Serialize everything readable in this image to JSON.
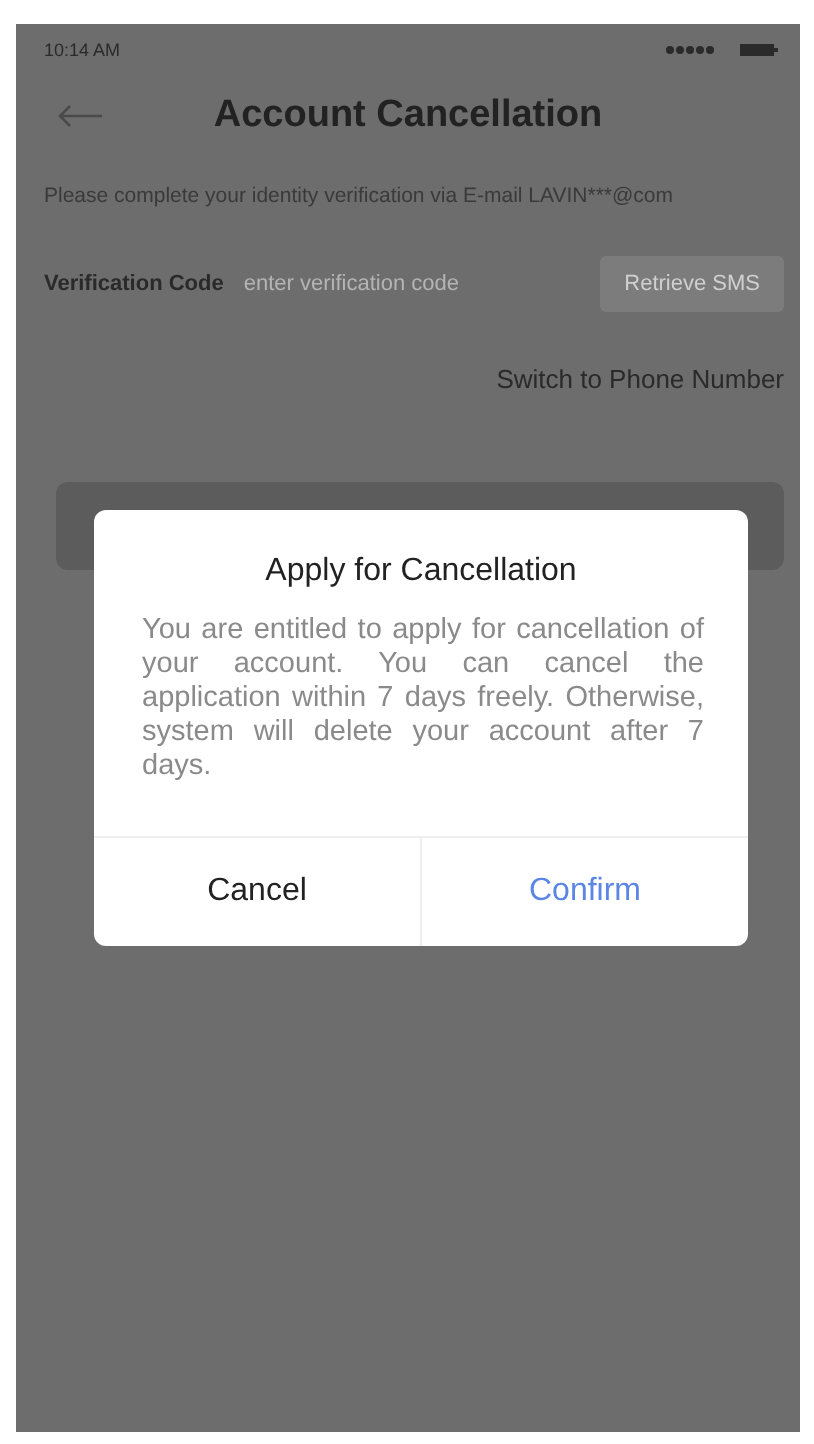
{
  "status_bar": {
    "time": "10:14 AM"
  },
  "header": {
    "title": "Account Cancellation"
  },
  "notice": "Please complete your identity verification via E-mail LAVIN***@com",
  "verification": {
    "label": "Verification Code",
    "placeholder": "enter verification code",
    "button": "Retrieve SMS"
  },
  "switch_link": "Switch to Phone Number",
  "dialog": {
    "title": "Apply for Cancellation",
    "message": "You are entitled to apply for cancellation of your account. You can cancel the application within 7 days freely. Otherwise, system will delete your account after 7 days.",
    "buttons": [
      {
        "label": "Cancel",
        "kind": "secondary"
      },
      {
        "label": "Confirm",
        "kind": "primary"
      }
    ]
  }
}
